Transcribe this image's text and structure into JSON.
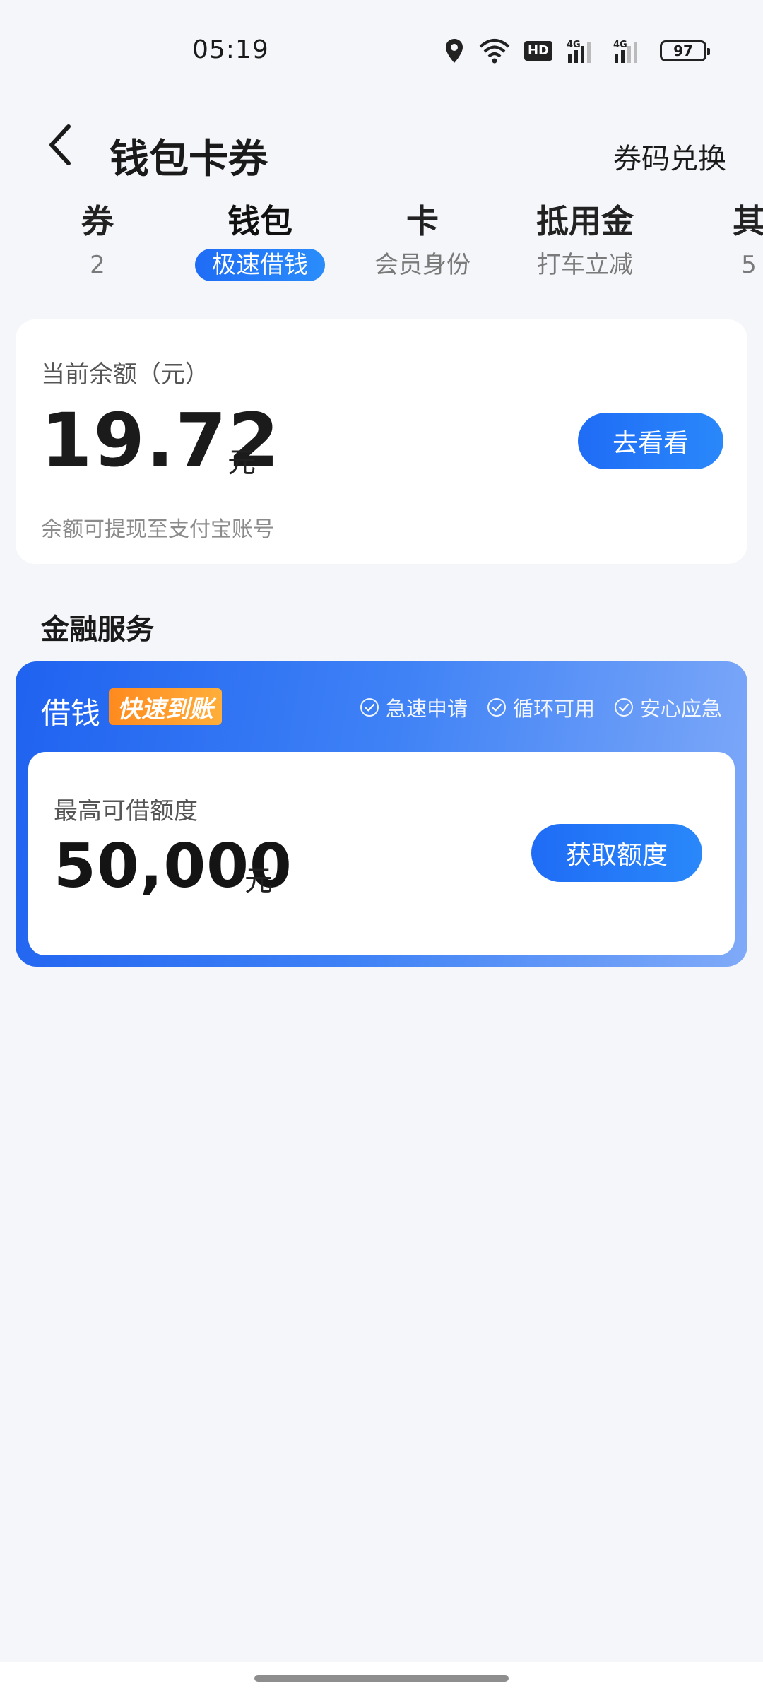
{
  "status_bar": {
    "time": "05:19",
    "icons": [
      "location-icon",
      "wifi-icon",
      "hd-badge",
      "signal-4g-icon",
      "signal-4g-icon"
    ],
    "hd_label": "HD",
    "network_label": "4G",
    "battery": "97"
  },
  "header": {
    "title": "钱包卡券",
    "back_icon": "chevron-left-icon",
    "redeem_label": "券码兑换"
  },
  "tabs": [
    {
      "label": "券",
      "sub": "2"
    },
    {
      "label": "钱包",
      "sub": "极速借钱",
      "active": true
    },
    {
      "label": "卡",
      "sub": "会员身份"
    },
    {
      "label": "抵用金",
      "sub": "打车立减"
    },
    {
      "label": "其",
      "sub": "5"
    }
  ],
  "balance": {
    "label": "当前余额（元）",
    "amount": "19.72",
    "unit": "元",
    "note": "余额可提现至支付宝账号",
    "button": "去看看"
  },
  "financial": {
    "section_title": "金融服务",
    "card_title": "借钱",
    "badge": "快速到账",
    "features": [
      "急速申请",
      "循环可用",
      "安心应急"
    ],
    "limit_label": "最高可借额度",
    "limit_amount": "50,000",
    "limit_unit": "元",
    "button": "获取额度"
  },
  "colors": {
    "accent": "#1f6cf6",
    "badge_orange": "#ff9a2a",
    "background": "#f4f6f9"
  }
}
